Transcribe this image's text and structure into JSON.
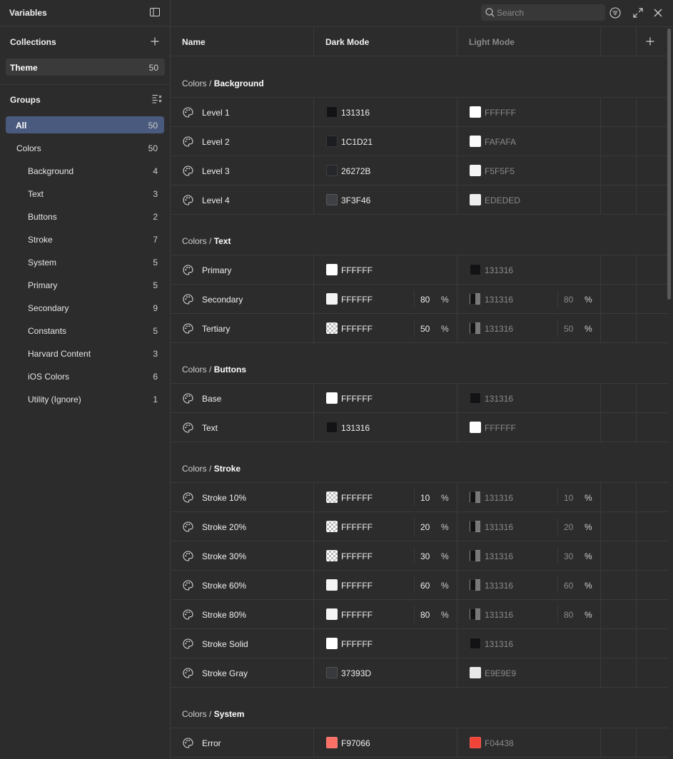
{
  "sidebar": {
    "title": "Variables",
    "collections_title": "Collections",
    "collection": {
      "label": "Theme",
      "count": "50"
    },
    "groups_title": "Groups",
    "groups": [
      {
        "label": "All",
        "count": "50",
        "indent": 0,
        "active": true
      },
      {
        "label": "Colors",
        "count": "50",
        "indent": 1
      },
      {
        "label": "Background",
        "count": "4",
        "indent": 2
      },
      {
        "label": "Text",
        "count": "3",
        "indent": 2
      },
      {
        "label": "Buttons",
        "count": "2",
        "indent": 2
      },
      {
        "label": "Stroke",
        "count": "7",
        "indent": 2
      },
      {
        "label": "System",
        "count": "5",
        "indent": 2
      },
      {
        "label": "Primary",
        "count": "5",
        "indent": 2
      },
      {
        "label": "Secondary",
        "count": "9",
        "indent": 2
      },
      {
        "label": "Constants",
        "count": "5",
        "indent": 2
      },
      {
        "label": "Harvard Content",
        "count": "3",
        "indent": 2
      },
      {
        "label": "iOS Colors",
        "count": "6",
        "indent": 2
      },
      {
        "label": "Utility (Ignore)",
        "count": "1",
        "indent": 2
      }
    ]
  },
  "toolbar": {
    "search_placeholder": "Search"
  },
  "table": {
    "columns": {
      "name": "Name",
      "dark": "Dark Mode",
      "light": "Light Mode"
    },
    "pct_symbol": "%",
    "sections": [
      {
        "prefix": "Colors / ",
        "name": "Background",
        "rows": [
          {
            "name": "Level 1",
            "dark": {
              "hex": "131316",
              "color": "#131316"
            },
            "light": {
              "hex": "FFFFFF",
              "color": "#FFFFFF"
            }
          },
          {
            "name": "Level 2",
            "dark": {
              "hex": "1C1D21",
              "color": "#1C1D21"
            },
            "light": {
              "hex": "FAFAFA",
              "color": "#FAFAFA"
            }
          },
          {
            "name": "Level 3",
            "dark": {
              "hex": "26272B",
              "color": "#26272B"
            },
            "light": {
              "hex": "F5F5F5",
              "color": "#F5F5F5"
            }
          },
          {
            "name": "Level 4",
            "dark": {
              "hex": "3F3F46",
              "color": "#3F3F46"
            },
            "light": {
              "hex": "EDEDED",
              "color": "#EDEDED"
            }
          }
        ]
      },
      {
        "prefix": "Colors / ",
        "name": "Text",
        "rows": [
          {
            "name": "Primary",
            "dark": {
              "hex": "FFFFFF",
              "color": "#FFFFFF"
            },
            "light": {
              "hex": "131316",
              "color": "#131316"
            }
          },
          {
            "name": "Secondary",
            "dark": {
              "hex": "FFFFFF",
              "color": "#FFFFFF",
              "alpha": "80"
            },
            "light": {
              "hex": "131316",
              "color": "#131316",
              "alpha": "80"
            }
          },
          {
            "name": "Tertiary",
            "dark": {
              "hex": "FFFFFF",
              "color": "#FFFFFF",
              "alpha": "50"
            },
            "light": {
              "hex": "131316",
              "color": "#131316",
              "alpha": "50"
            }
          }
        ]
      },
      {
        "prefix": "Colors / ",
        "name": "Buttons",
        "rows": [
          {
            "name": "Base",
            "dark": {
              "hex": "FFFFFF",
              "color": "#FFFFFF"
            },
            "light": {
              "hex": "131316",
              "color": "#131316"
            }
          },
          {
            "name": "Text",
            "dark": {
              "hex": "131316",
              "color": "#131316"
            },
            "light": {
              "hex": "FFFFFF",
              "color": "#FFFFFF"
            }
          }
        ]
      },
      {
        "prefix": "Colors / ",
        "name": "Stroke",
        "rows": [
          {
            "name": "Stroke 10%",
            "dark": {
              "hex": "FFFFFF",
              "color": "#FFFFFF",
              "alpha": "10"
            },
            "light": {
              "hex": "131316",
              "color": "#131316",
              "alpha": "10"
            }
          },
          {
            "name": "Stroke 20%",
            "dark": {
              "hex": "FFFFFF",
              "color": "#FFFFFF",
              "alpha": "20"
            },
            "light": {
              "hex": "131316",
              "color": "#131316",
              "alpha": "20"
            }
          },
          {
            "name": "Stroke 30%",
            "dark": {
              "hex": "FFFFFF",
              "color": "#FFFFFF",
              "alpha": "30"
            },
            "light": {
              "hex": "131316",
              "color": "#131316",
              "alpha": "30"
            }
          },
          {
            "name": "Stroke 60%",
            "dark": {
              "hex": "FFFFFF",
              "color": "#FFFFFF",
              "alpha": "60"
            },
            "light": {
              "hex": "131316",
              "color": "#131316",
              "alpha": "60"
            }
          },
          {
            "name": "Stroke 80%",
            "dark": {
              "hex": "FFFFFF",
              "color": "#FFFFFF",
              "alpha": "80"
            },
            "light": {
              "hex": "131316",
              "color": "#131316",
              "alpha": "80"
            }
          },
          {
            "name": "Stroke Solid",
            "dark": {
              "hex": "FFFFFF",
              "color": "#FFFFFF"
            },
            "light": {
              "hex": "131316",
              "color": "#131316"
            }
          },
          {
            "name": "Stroke Gray",
            "dark": {
              "hex": "37393D",
              "color": "#37393D"
            },
            "light": {
              "hex": "E9E9E9",
              "color": "#E9E9E9"
            }
          }
        ]
      },
      {
        "prefix": "Colors / ",
        "name": "System",
        "rows": [
          {
            "name": "Error",
            "dark": {
              "hex": "F97066",
              "color": "#F97066"
            },
            "light": {
              "hex": "F04438",
              "color": "#F04438"
            }
          }
        ]
      }
    ]
  }
}
